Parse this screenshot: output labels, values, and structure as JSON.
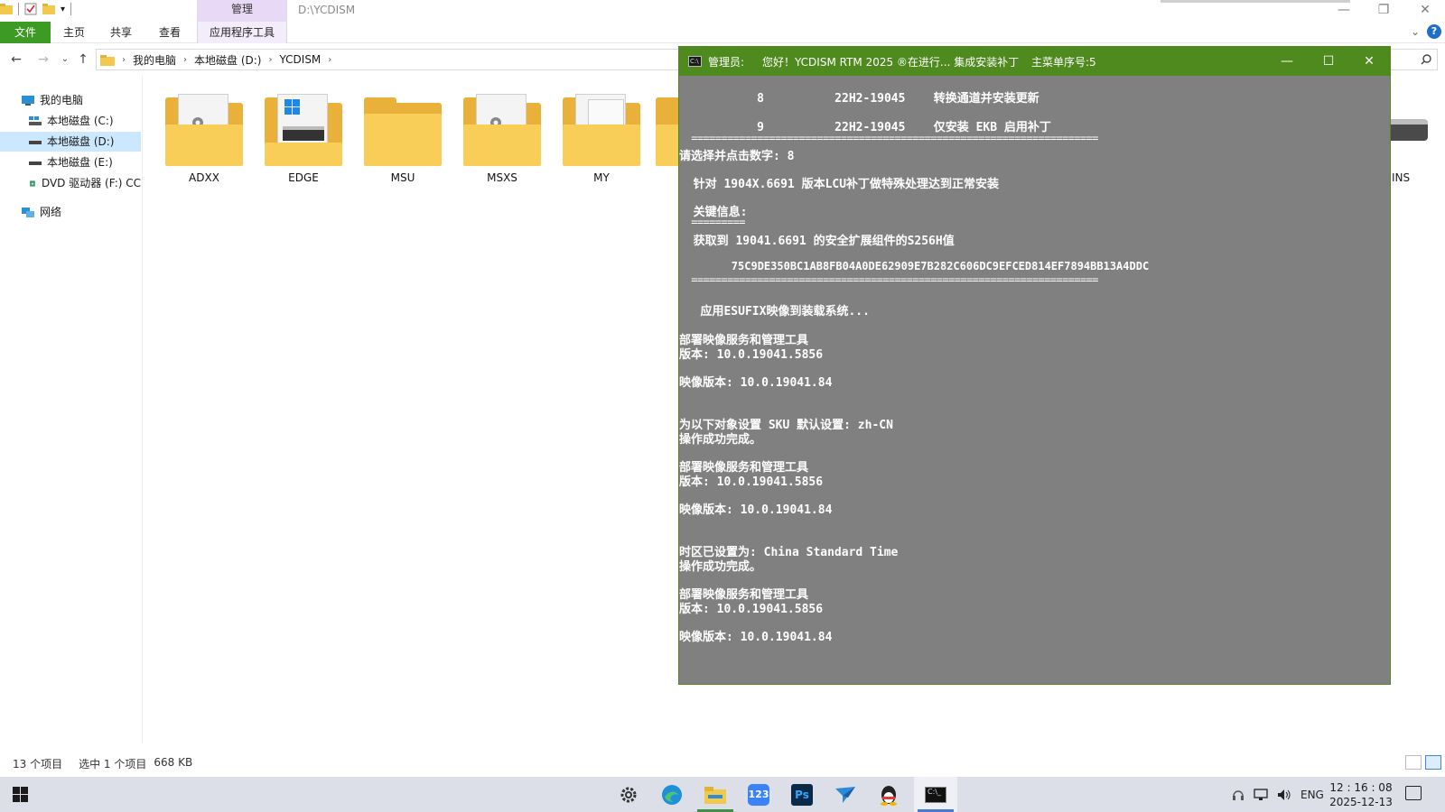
{
  "explorer": {
    "window_path": "D:\\YCDISM",
    "context_tab_group": "管理",
    "ribbon_tabs": [
      "文件",
      "主页",
      "共享",
      "查看",
      "应用程序工具"
    ],
    "breadcrumb": [
      "我的电脑",
      "本地磁盘 (D:)",
      "YCDISM"
    ],
    "nav_tree": [
      {
        "label": "我的电脑",
        "icon": "computer-icon"
      },
      {
        "label": "本地磁盘 (C:)",
        "icon": "windows-drive-icon"
      },
      {
        "label": "本地磁盘 (D:)",
        "icon": "drive-icon",
        "selected": true
      },
      {
        "label": "本地磁盘 (E:)",
        "icon": "drive-icon"
      },
      {
        "label": "DVD 驱动器 (F:) CC",
        "icon": "dvd-icon"
      },
      {
        "label": "网络",
        "icon": "network-icon"
      }
    ],
    "items": [
      {
        "label": "ADXX",
        "icon": "folder-settings-icon"
      },
      {
        "label": "EDGE",
        "icon": "folder-windows-icon"
      },
      {
        "label": "MSU",
        "icon": "folder-icon"
      },
      {
        "label": "MSXS",
        "icon": "folder-settings-icon"
      },
      {
        "label": "MY",
        "icon": "folder-documents-icon"
      }
    ],
    "partial_item_label": "INS",
    "status_count": "13 个项目",
    "status_selected": "选中 1 个项目",
    "status_size": "668 KB"
  },
  "console": {
    "title_role": "管理员:",
    "title_main": "您好！YCDISM RTM 2025 ®在进行... 集成安装补丁",
    "title_menu": "主菜单序号:5",
    "lines": [
      "           8          22H2-19045    转换通道并安装更新",
      "           9          22H2-19045    仅安装 EKB 启用补丁",
      "  ====================================================================",
      "请选择并点击数字: 8",
      "  针对 1904X.6691 版本LCU补丁做特殊处理达到正常安装",
      "  关键信息:",
      "  =========",
      "  获取到 19041.6691 的安全扩展组件的S256H值",
      "        75C9DE350BC1AB8FB04A0DE62909E7B282C606DC9EFCED814EF7894BB13A4DDC",
      "  ====================================================================",
      "   应用ESUFIX映像到装载系统...",
      "部署映像服务和管理工具",
      "版本: 10.0.19041.5856",
      "映像版本: 10.0.19041.84",
      "为以下对象设置 SKU 默认设置: zh-CN",
      "操作成功完成。",
      "部署映像服务和管理工具",
      "版本: 10.0.19041.5856",
      "映像版本: 10.0.19041.84",
      "时区已设置为: China Standard Time",
      "操作成功完成。",
      "部署映像服务和管理工具",
      "版本: 10.0.19041.5856",
      "映像版本: 10.0.19041.84"
    ]
  },
  "taskbar": {
    "apps": [
      "settings-icon",
      "edge-icon",
      "file-explorer-icon",
      "123pan-icon",
      "photoshop-icon",
      "feishu-icon",
      "qq-icon",
      "terminal-icon"
    ],
    "app_123_label": "123",
    "app_ps_label": "Ps",
    "lang": "ENG",
    "time": "12 : 16 : 08",
    "date": "2025-12-13"
  },
  "colors": {
    "file_tab": "#3d9a25",
    "console_bg": "#808080",
    "console_title": "#4f8a1e",
    "folder": "#f8cd58"
  }
}
